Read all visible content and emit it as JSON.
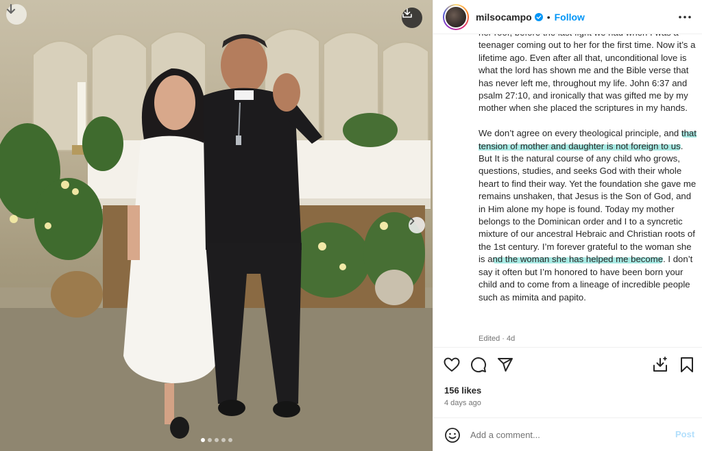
{
  "photo": {
    "carousel_count": 5,
    "active_index": 0,
    "icons": {
      "top_left": "download-arrow-icon",
      "top_right": "download-tray-icon",
      "next": "chevron-right-icon"
    }
  },
  "header": {
    "username": "milsocampo",
    "separator": "•",
    "follow_label": "Follow",
    "verified_icon": "verified-badge-icon",
    "more_icon": "more-horizontal-icon"
  },
  "caption": {
    "p1": "her roof, before the last fight we had when I was a teenager coming out to her for the first time. Now it’s a lifetime ago. Even after all that, unconditional love is what the lord has shown me and the Bible verse that has never left me, throughout my life. John 6:37 and psalm 27:10, and ironically that was gifted me by my mother when she placed the scriptures in my hands.",
    "p2_a": "We don’t agree on every theological principle, and ",
    "p2_hl1": "that tension of mother and daughter is not foreign to us",
    "p2_b": ". But It is the natural course of any child who grows, questions, studies, and seeks God with their whole heart to find their way. Yet the foundation she gave me remains unshaken, that Jesus is the Son of God, and in Him alone my hope is found. Today my mother belongs to the Dominican order and I to a syncretic mixture of our ancestral Hebraic and Christian roots of the 1st century. I’m forever grateful to the woman she is a",
    "p2_hl2": "nd the woman she has helped me become",
    "p2_c": ". I don’t say it often but I’m honored to have been born your child and to come from a lineage of incredible people such as mimita and papito."
  },
  "meta": {
    "edited": "Edited · 4d"
  },
  "actions": {
    "icons": [
      "heart-icon",
      "comment-icon",
      "share-icon",
      "save-to-collection-icon",
      "bookmark-icon"
    ]
  },
  "likes": "156 likes",
  "time_ago": "4 days ago",
  "comment": {
    "placeholder": "Add a comment...",
    "post_label": "Post",
    "emoji_icon": "emoji-icon"
  },
  "colors": {
    "accent": "#0095f6",
    "post_disabled": "#b2dffc",
    "highlight": "#a8ebe4",
    "muted": "#737373"
  }
}
